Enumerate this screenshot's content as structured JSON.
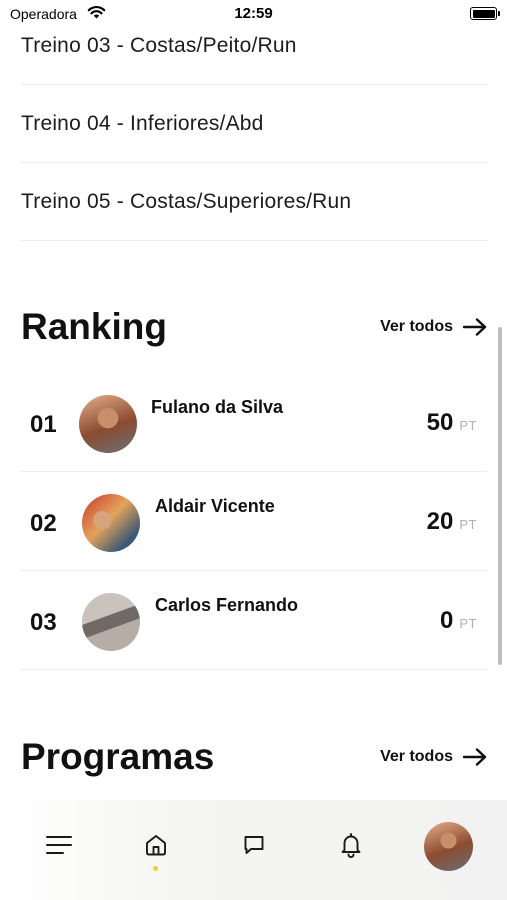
{
  "status_bar": {
    "carrier": "Operadora",
    "time": "12:59"
  },
  "workouts": [
    {
      "title": "Treino 03 - Costas/Peito/Run"
    },
    {
      "title": "Treino 04 - Inferiores/Abd"
    },
    {
      "title": "Treino 05 - Costas/Superiores/Run"
    }
  ],
  "ranking": {
    "title": "Ranking",
    "see_all_label": "Ver todos",
    "entries": [
      {
        "position": "01",
        "name": "Fulano da Silva",
        "points": "50",
        "unit": "PT"
      },
      {
        "position": "02",
        "name": "Aldair Vicente",
        "points": "20",
        "unit": "PT"
      },
      {
        "position": "03",
        "name": "Carlos Fernando",
        "points": "0",
        "unit": "PT"
      }
    ]
  },
  "programs": {
    "title": "Programas",
    "see_all_label": "Ver todos"
  },
  "tab_bar": {
    "items": [
      {
        "icon": "menu-icon"
      },
      {
        "icon": "home-icon",
        "active": true
      },
      {
        "icon": "chat-icon"
      },
      {
        "icon": "bell-icon"
      },
      {
        "icon": "profile-avatar"
      }
    ],
    "active_color": "#f3d21d"
  }
}
